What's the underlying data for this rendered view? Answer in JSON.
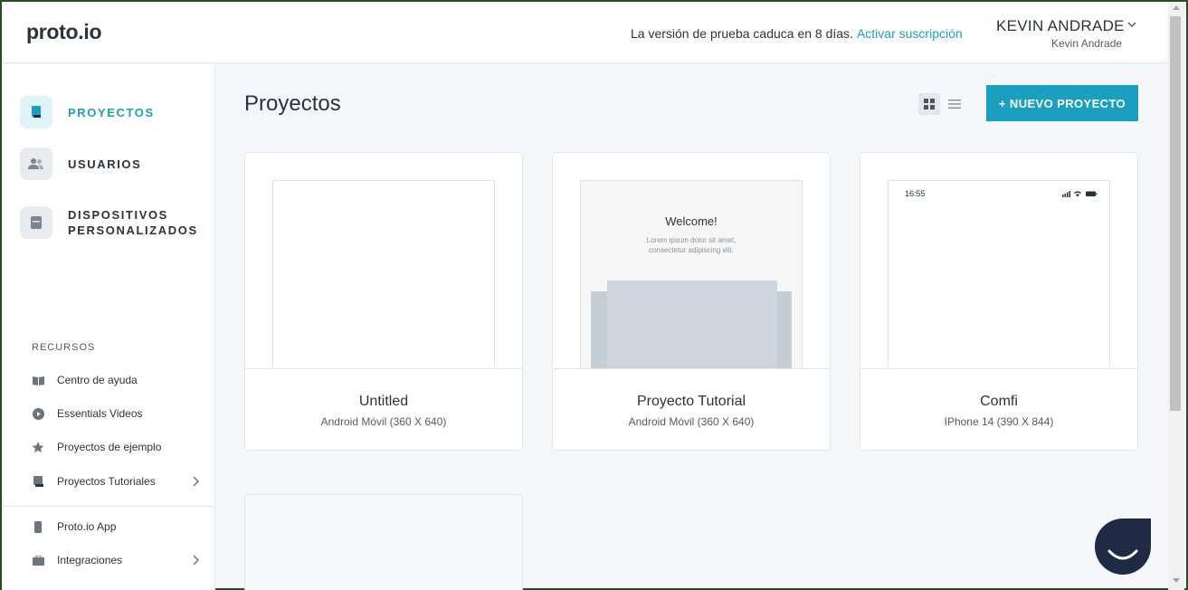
{
  "header": {
    "logo": "proto.io",
    "trial_text": "La versión de prueba caduca en 8 días.",
    "trial_link": "Activar suscripción",
    "user_name": "KEVIN ANDRADE",
    "user_sub": "Kevin Andrade"
  },
  "sidebar": {
    "nav": [
      {
        "label": "PROYECTOS",
        "icon": "book-icon",
        "active": true
      },
      {
        "label": "USUARIOS",
        "icon": "users-icon",
        "active": false
      },
      {
        "label": "DISPOSITIVOS PERSONALIZADOS",
        "icon": "device-icon",
        "active": false
      }
    ],
    "resources_title": "RECURSOS",
    "resources": [
      {
        "label": "Centro de ayuda",
        "icon": "open-book-icon"
      },
      {
        "label": "Essentials Videos",
        "icon": "play-icon"
      },
      {
        "label": "Proyectos de ejemplo",
        "icon": "star-icon"
      },
      {
        "label": "Proyectos Tutoriales",
        "icon": "book-icon"
      },
      {
        "label": "Proto.io App",
        "icon": "phone-icon"
      },
      {
        "label": "Integraciones",
        "icon": "briefcase-icon"
      }
    ]
  },
  "main": {
    "title": "Proyectos",
    "new_project_label": "+ NUEVO PROYECTO",
    "projects": [
      {
        "name": "Untitled",
        "device": "Android Móvil (360 X 640)"
      },
      {
        "name": "Proyecto Tutorial",
        "device": "Android Móvil (360 X 640)",
        "preview_title": "Welcome!",
        "preview_text": "Lorem ipsum dolor sit amet, consectetur adipiscing elit."
      },
      {
        "name": "Comfi",
        "device": "IPhone 14 (390 X 844)",
        "preview_time": "16:55"
      }
    ]
  },
  "colors": {
    "accent": "#1a9fc0",
    "text": "#2a333d",
    "chat": "#1f2a44"
  }
}
